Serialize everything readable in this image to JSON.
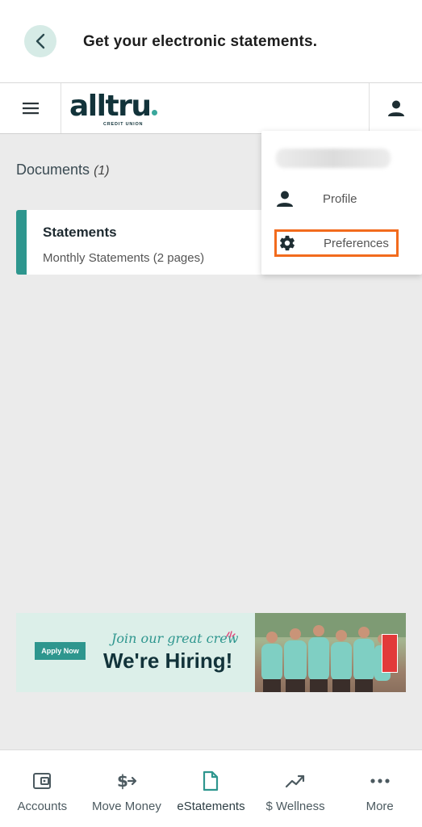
{
  "header": {
    "title": "Get your electronic statements."
  },
  "appbar": {
    "logo_text": "alltru",
    "logo_subtext": "CREDIT UNION"
  },
  "documents": {
    "heading": "Documents",
    "count": "(1)",
    "items": [
      {
        "title": "Statements",
        "subtitle": "Monthly Statements (2 pages)"
      }
    ]
  },
  "account_menu": {
    "items": [
      {
        "label": "Profile",
        "icon": "person-icon"
      },
      {
        "label": "Preferences",
        "icon": "gear-icon"
      }
    ]
  },
  "banner": {
    "apply_label": "Apply Now",
    "tagline": "Join our great crew",
    "headline": "We're Hiring!"
  },
  "bottom_nav": {
    "items": [
      {
        "label": "Accounts",
        "icon": "wallet-icon"
      },
      {
        "label": "Move Money",
        "icon": "dollar-arrow-icon"
      },
      {
        "label": "eStatements",
        "icon": "document-icon"
      },
      {
        "label": "$ Wellness",
        "icon": "trending-up-icon"
      },
      {
        "label": "More",
        "icon": "more-dots-icon"
      }
    ]
  },
  "colors": {
    "accent": "#2e968e",
    "highlight": "#f26b1d",
    "brand_dark": "#12333a"
  }
}
